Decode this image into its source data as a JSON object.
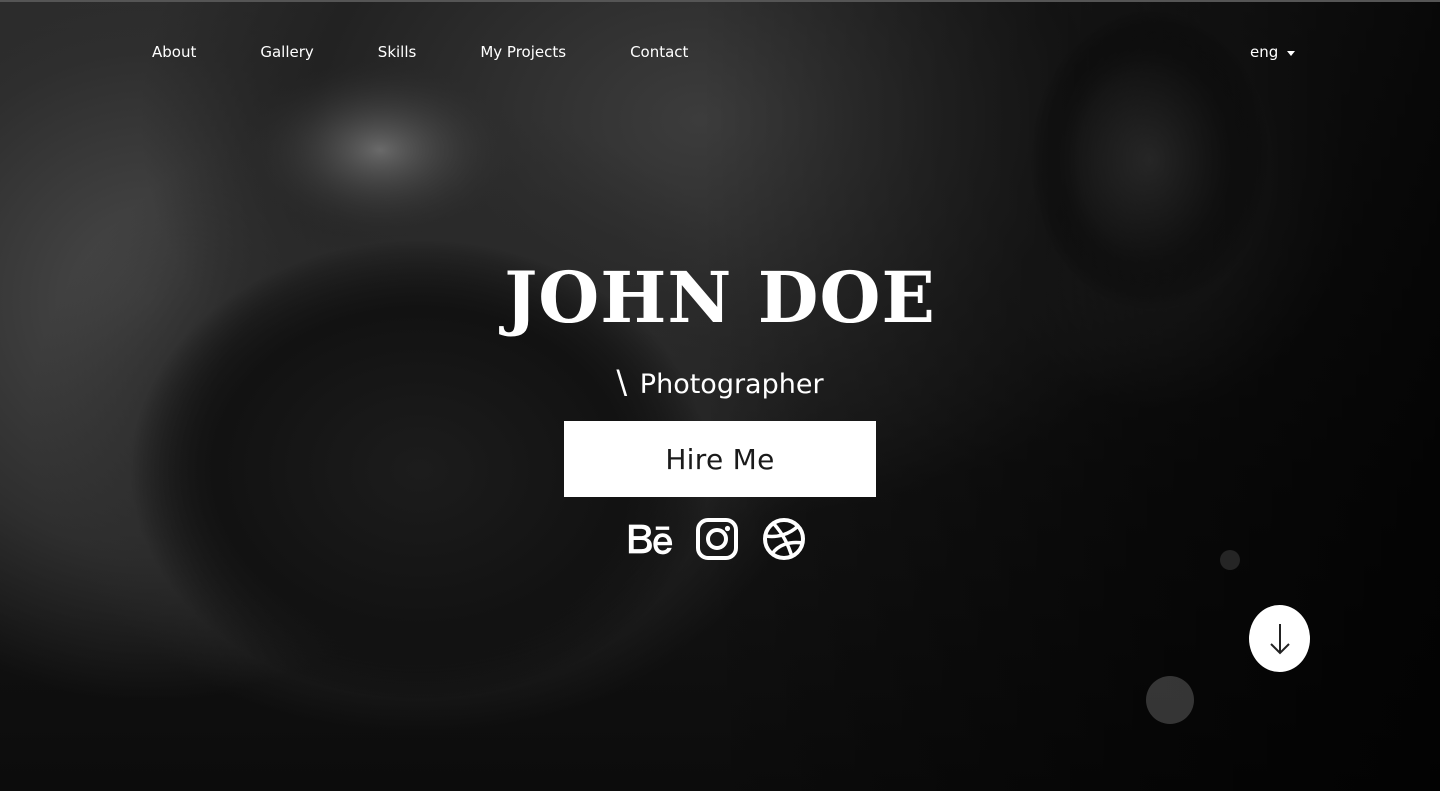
{
  "nav": {
    "items": [
      {
        "label": "About"
      },
      {
        "label": "Gallery"
      },
      {
        "label": "Skills"
      },
      {
        "label": "My Projects"
      },
      {
        "label": "Contact"
      }
    ]
  },
  "language": {
    "selected": "eng"
  },
  "hero": {
    "name": "JOHN DOE",
    "role_prefix": "\\",
    "role": "Photographer",
    "cta_label": "Hire Me"
  },
  "socials": [
    {
      "icon": "behance-icon"
    },
    {
      "icon": "instagram-icon"
    },
    {
      "icon": "dribbble-icon"
    }
  ],
  "scroll_button": {
    "icon": "arrow-down-icon"
  },
  "colors": {
    "text": "#ffffff",
    "button_bg": "#ffffff",
    "button_text": "#1a1a1a"
  }
}
